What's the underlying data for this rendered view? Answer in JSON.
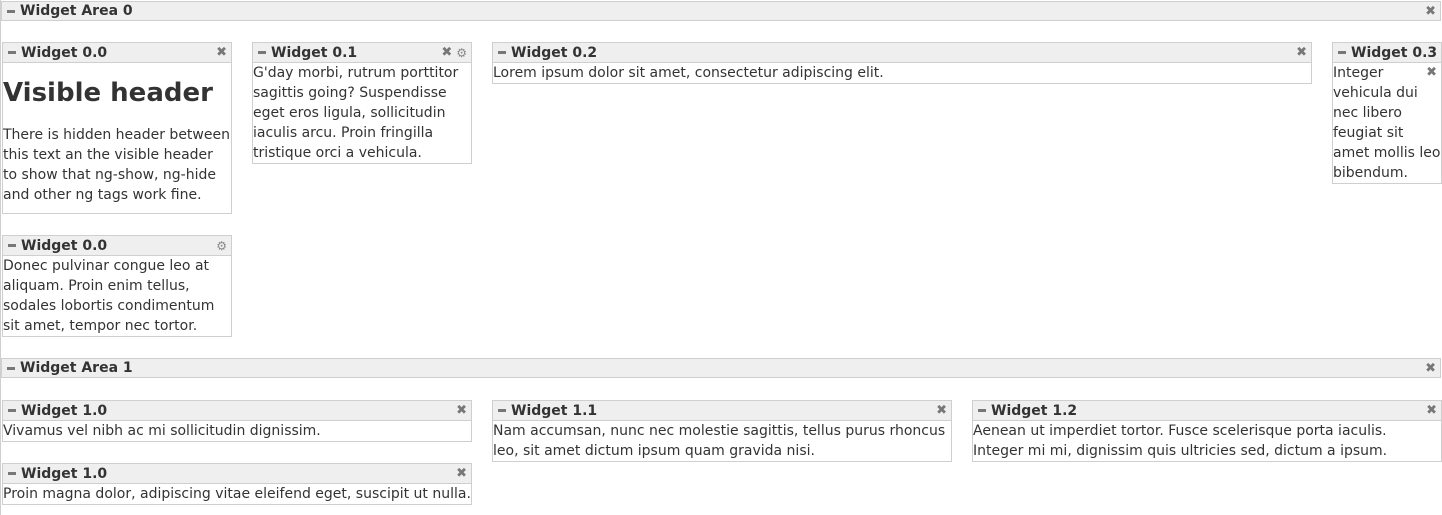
{
  "areas": [
    {
      "title": "Widget Area 0",
      "widgets": [
        {
          "title": "Widget 0.0",
          "header": "Visible header",
          "text": "There is hidden header between this text an the visible header to show that ng-show, ng-hide and other ng tags work fine."
        },
        {
          "title": "Widget 0.1",
          "text": "G'day morbi, rutrum porttitor sagittis going? Suspendisse eget eros ligula, sollicitudin iaculis arcu. Proin fringilla tristique orci a vehicula."
        },
        {
          "title": "Widget 0.2",
          "text": "Lorem ipsum dolor sit amet, consectetur adipiscing elit."
        },
        {
          "title": "Widget 0.3",
          "text": "Integer vehicula dui nec libero feugiat sit amet mollis leo bibendum."
        },
        {
          "title": "Widget 0.0",
          "text": "Donec pulvinar congue leo at aliquam. Proin enim tellus, sodales lobortis condimentum sit amet, tempor nec tortor."
        }
      ]
    },
    {
      "title": "Widget Area 1",
      "widgets": [
        {
          "title": "Widget 1.0",
          "text": "Vivamus vel nibh ac mi sollicitudin dignissim."
        },
        {
          "title": "Widget 1.1",
          "text": "Nam accumsan, nunc nec molestie sagittis, tellus purus rhoncus leo, sit amet dictum ipsum quam gravida nisi."
        },
        {
          "title": "Widget 1.2",
          "text": "Aenean ut imperdiet tortor. Fusce scelerisque porta iaculis. Integer mi mi, dignissim quis ultricies sed, dictum a ipsum."
        },
        {
          "title": "Widget 1.0",
          "text": "Proin magna dolor, adipiscing vitae eleifend eget, suscipit ut nulla."
        }
      ]
    }
  ],
  "icons": {
    "close": "close-icon",
    "settings": "gear-icon",
    "collapse": "minus-icon"
  },
  "colors": {
    "header_bg": "#efefef",
    "border": "#cfcfcf",
    "text": "#333333",
    "icon": "#777777"
  }
}
